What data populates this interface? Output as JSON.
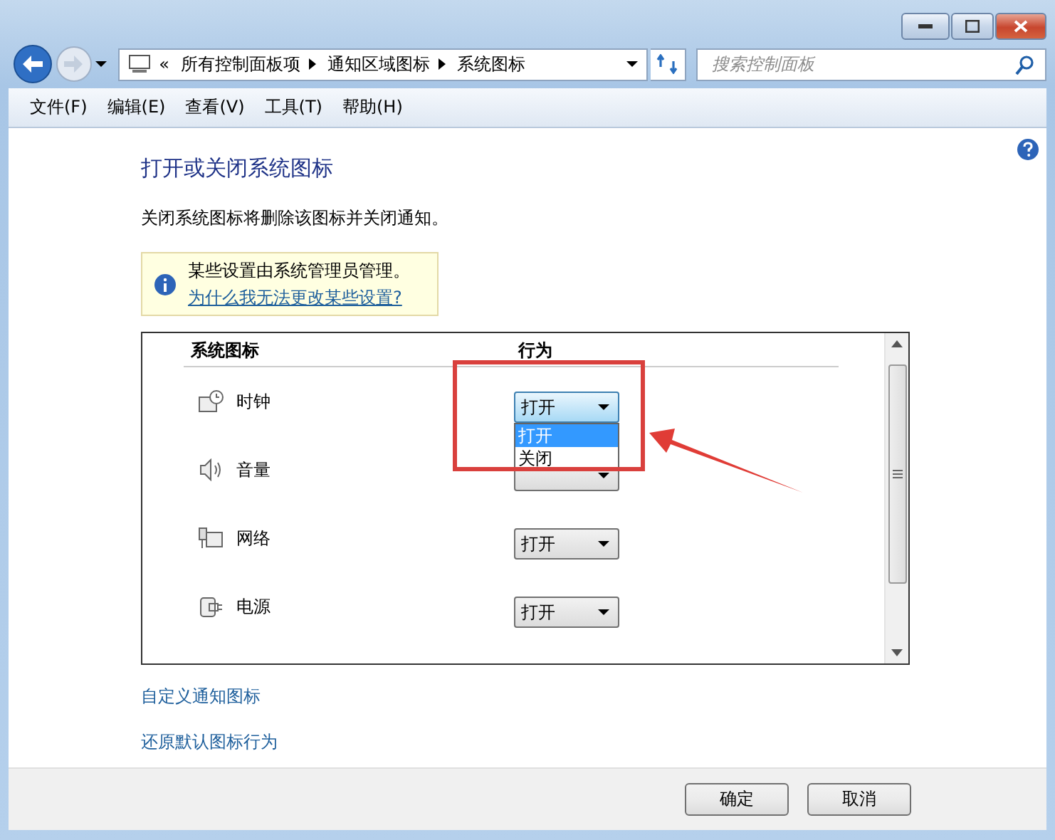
{
  "address_bar": {
    "overflow": "«",
    "path": [
      "所有控制面板项",
      "通知区域图标",
      "系统图标"
    ]
  },
  "search": {
    "placeholder": "搜索控制面板"
  },
  "menu": [
    "文件(F)",
    "编辑(E)",
    "查看(V)",
    "工具(T)",
    "帮助(H)"
  ],
  "heading": "打开或关闭系统图标",
  "description": "关闭系统图标将删除该图标并关闭通知。",
  "notice": {
    "text": "某些设置由系统管理员管理。",
    "link": "为什么我无法更改某些设置?"
  },
  "table": {
    "columns": [
      "系统图标",
      "行为"
    ],
    "rows": [
      {
        "kind": "clock",
        "name": "时钟",
        "value": "打开",
        "expanded": true,
        "options": [
          {
            "label": "打开",
            "selected": true
          },
          {
            "label": "关闭",
            "selected": false
          }
        ]
      },
      {
        "kind": "volume",
        "name": "音量",
        "expanded": false
      },
      {
        "kind": "network",
        "name": "网络",
        "value": "打开",
        "expanded": false
      },
      {
        "kind": "power",
        "name": "电源",
        "value": "打开",
        "expanded": false
      }
    ]
  },
  "annotation": {
    "kind": "box-arrow"
  },
  "links": [
    "自定义通知图标",
    "还原默认图标行为"
  ],
  "buttons": [
    "确定",
    "取消"
  ]
}
